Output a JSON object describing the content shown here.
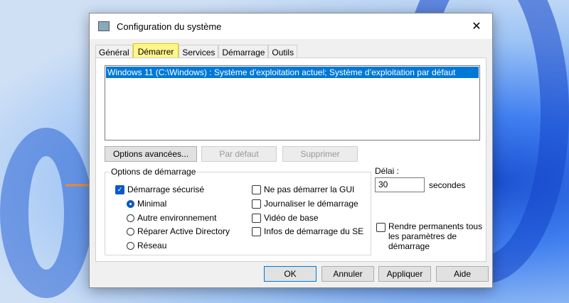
{
  "window": {
    "title": "Configuration du système",
    "close": "✕"
  },
  "tabs": [
    "Général",
    "Démarrer",
    "Services",
    "Démarrage",
    "Outils"
  ],
  "boot_list": [
    "Windows 11 (C:\\Windows) : Système d’exploitation actuel; Système d’exploitation par défaut"
  ],
  "buttons": {
    "advanced": "Options avancées...",
    "default": "Par défaut",
    "delete": "Supprimer",
    "ok": "OK",
    "cancel": "Annuler",
    "apply": "Appliquer",
    "help": "Aide"
  },
  "boot_options": {
    "legend": "Options de démarrage",
    "safe_boot": "Démarrage sécurisé",
    "minimal": "Minimal",
    "alternate_shell": "Autre environnement",
    "ad_repair": "Réparer Active Directory",
    "network": "Réseau",
    "no_gui": "Ne pas démarrer la GUI",
    "boot_log": "Journaliser le démarrage",
    "base_video": "Vidéo de base",
    "os_info": "Infos de démarrage du SE"
  },
  "timeout": {
    "label": "Délai :",
    "value": "30",
    "unit": "secondes"
  },
  "permanent": "Rendre permanents tous les paramètres de démarrage"
}
